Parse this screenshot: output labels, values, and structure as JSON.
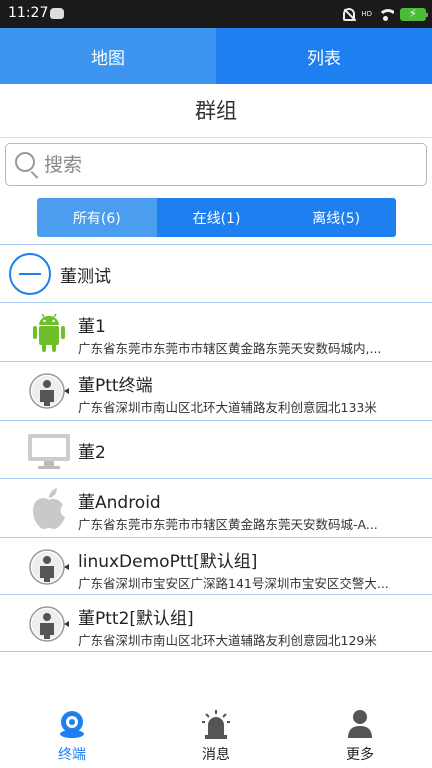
{
  "status_bar": {
    "time": "11:27",
    "hd": "HD",
    "battery_icon": "charging-battery-icon",
    "accent": "#4cbb3a"
  },
  "top_tabs": [
    {
      "label": "地图"
    },
    {
      "label": "列表"
    }
  ],
  "title": "群组",
  "search": {
    "placeholder": "搜索",
    "value": ""
  },
  "filters": [
    {
      "label": "所有(6)",
      "active": true
    },
    {
      "label": "在线(1)",
      "active": false
    },
    {
      "label": "离线(5)",
      "active": false
    }
  ],
  "group": {
    "name": "董测试"
  },
  "devices": [
    {
      "name": "董1",
      "address": "广东省东莞市东莞市市辖区黄金路东莞天安数码城内,...",
      "icon": "android-icon"
    },
    {
      "name": "董Ptt终端",
      "address": "广东省深圳市南山区北环大道辅路友利创意园北133米",
      "icon": "ptt-user-icon"
    },
    {
      "name": "董2",
      "address": "",
      "icon": "monitor-icon"
    },
    {
      "name": "董Android",
      "address": "广东省东莞市东莞市市辖区黄金路东莞天安数码城-A...",
      "icon": "apple-icon"
    },
    {
      "name": "linuxDemoPtt[默认组]",
      "address": "广东省深圳市宝安区广深路141号深圳市宝安区交警大...",
      "icon": "ptt-user-icon"
    },
    {
      "name": "董Ptt2[默认组]",
      "address": "广东省深圳市南山区北环大道辅路友利创意园北129米",
      "icon": "ptt-user-icon"
    }
  ],
  "bottom_nav": [
    {
      "label": "终端",
      "icon": "terminal-icon",
      "active": true
    },
    {
      "label": "消息",
      "icon": "alarm-icon",
      "active": false
    },
    {
      "label": "更多",
      "icon": "person-icon",
      "active": false
    }
  ],
  "colors": {
    "primary": "#1e7ff0",
    "tab_left": "#3d95ef",
    "segment_active": "#4b9df0",
    "android_green": "#6fbf2b"
  }
}
